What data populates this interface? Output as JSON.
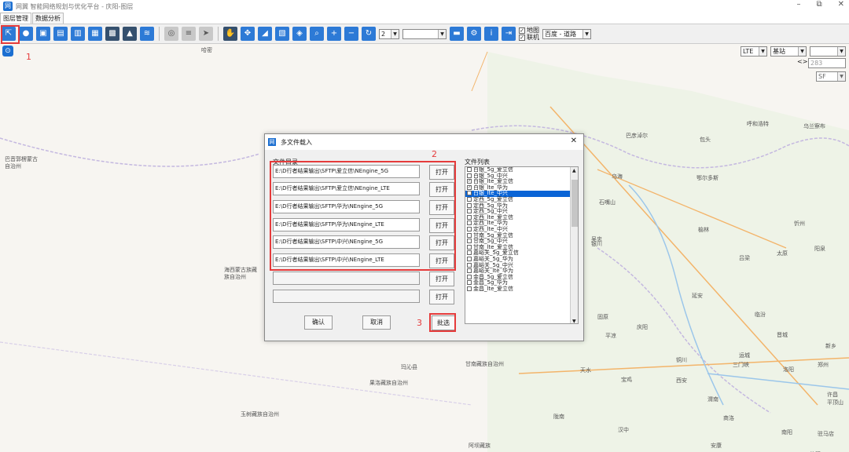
{
  "window": {
    "title": "网翼 智能网络规划与优化平台 - 庆阳-图层",
    "min": "–",
    "restore": "⧉",
    "close": "✕"
  },
  "menu_tabs": [
    "图层管理",
    "数据分析"
  ],
  "toolbar": {
    "layer_select": "2",
    "map_checkbox_label": "地图",
    "online_checkbox_label": "联机",
    "map_source": "百度 - 道路"
  },
  "right_panel": {
    "net_select": "LTE",
    "type_select": "基站",
    "count": "283",
    "sf": "SF",
    "nav": "<>"
  },
  "annotations": {
    "n1": "1",
    "n2": "2",
    "n3": "3"
  },
  "map_labels": [
    "哈密",
    "巴音郭楞蒙古自治州",
    "海西蒙古族藏族自治州",
    "玛沁县",
    "果洛藏族自治州",
    "甘南藏族自治州",
    "玉树藏族自治州",
    "阿坝藏族",
    "呼和浩特",
    "巴彦淖尔",
    "包头",
    "乌海",
    "鄂尔多斯",
    "石嘴山",
    "银川",
    "榆林",
    "吴忠",
    "吕梁",
    "太原",
    "延安",
    "临汾",
    "庆阳",
    "固原",
    "平凉",
    "天水",
    "宝鸡",
    "铜川",
    "运城",
    "三门峡",
    "洛阳",
    "郑州",
    "西安",
    "渭南",
    "商洛",
    "陇南",
    "汉中",
    "安康",
    "南阳",
    "许昌",
    "平顶山",
    "驻马店",
    "阳泉",
    "忻州",
    "晋城",
    "新乡",
    "信阳",
    "乌兰察布"
  ],
  "dialog": {
    "title": "多文件载入",
    "dir_label": "文件目录",
    "list_label": "文件列表",
    "paths": [
      "E:\\D行者结果输出\\SFTP\\爱立信\\NEngine_5G",
      "E:\\D行者结果输出\\SFTP\\爱立信\\NEngine_LTE",
      "E:\\D行者结果输出\\SFTP\\华为\\NEngine_5G",
      "E:\\D行者结果输出\\SFTP\\华为\\NEngine_LTE",
      "E:\\D行者结果输出\\SFTP\\中兴\\NEngine_5G",
      "E:\\D行者结果输出\\SFTP\\中兴\\NEngine_LTE",
      "",
      ""
    ],
    "open_label": "打开",
    "confirm_label": "确认",
    "cancel_label": "取消",
    "batch_label": "批选",
    "files": [
      {
        "name": "白银_5g_爱立信",
        "checked": false
      },
      {
        "name": "白银_5g_中兴",
        "checked": false
      },
      {
        "name": "白银_lte_爱立信",
        "checked": true
      },
      {
        "name": "白银_lte_华为",
        "checked": true
      },
      {
        "name": "白银_lte_中兴",
        "checked": true,
        "selected": true
      },
      {
        "name": "定西_5g_爱立信",
        "checked": false
      },
      {
        "name": "定西_5g_华为",
        "checked": false
      },
      {
        "name": "定西_5g_中兴",
        "checked": false
      },
      {
        "name": "定西_lte_爱立信",
        "checked": false
      },
      {
        "name": "定西_lte_华为",
        "checked": false
      },
      {
        "name": "定西_lte_中兴",
        "checked": false
      },
      {
        "name": "甘南_5g_爱立信",
        "checked": false
      },
      {
        "name": "甘南_5g_中兴",
        "checked": false
      },
      {
        "name": "甘南_lte_爱立信",
        "checked": false
      },
      {
        "name": "嘉峪关_5g_爱立信",
        "checked": false
      },
      {
        "name": "嘉峪关_5g_华为",
        "checked": false
      },
      {
        "name": "嘉峪关_5g_中兴",
        "checked": false
      },
      {
        "name": "嘉峪关_lte_华为",
        "checked": false
      },
      {
        "name": "金昌_5g_爱立信",
        "checked": false
      },
      {
        "name": "金昌_5g_华为",
        "checked": false
      },
      {
        "name": "金昌_lte_爱立信",
        "checked": false
      }
    ]
  },
  "colors": {
    "accent": "#1c6fd1",
    "highlight": "#e53b3b",
    "selected": "#0a64d6"
  }
}
